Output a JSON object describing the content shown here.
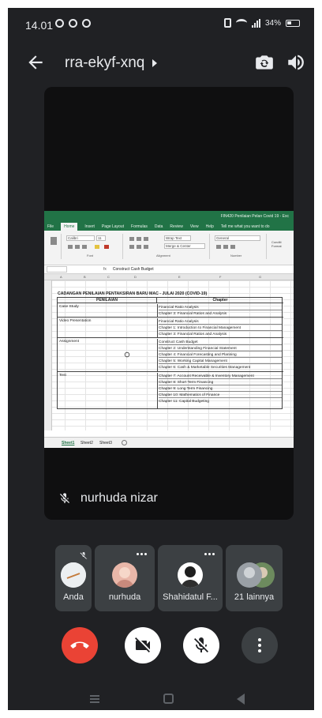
{
  "status_bar": {
    "time": "14.01",
    "battery": "34%"
  },
  "meeting": {
    "code": "rra-ekyf-xnq"
  },
  "presenter": {
    "name": "nurhuda nizar"
  },
  "excel": {
    "window_title": "FIN420 Penilaian Pelan Covid 19 - Exc",
    "tabs": [
      "File",
      "Home",
      "Insert",
      "Page Layout",
      "Formulas",
      "Data",
      "Review",
      "View",
      "Help",
      "Tell me what you want to do"
    ],
    "ribbon": {
      "font_name": "Calibri",
      "font_size": "11",
      "wrap_text": "Wrap Text",
      "merge_center": "Merge & Center",
      "number_format": "General",
      "groups": [
        "Font",
        "Alignment",
        "Number"
      ],
      "conditional": "Conditi Format"
    },
    "formula_bar": {
      "fx": "fx",
      "value": "Construct Cash Budget"
    },
    "columns": [
      "A",
      "B",
      "C",
      "D",
      "E",
      "F",
      "G"
    ],
    "caption": "CADANGAN PENILAIAN PENTAKSIRAN BARU MAC - JULAI 2020 (COVID-19)",
    "headers": [
      "PENILAIAN",
      "Chapter"
    ],
    "rows": [
      {
        "assessment": "Case Study",
        "chapters": [
          "Financial Ratio Analysis",
          "Chapter 3: Financial Ratios and Analysis"
        ]
      },
      {
        "assessment": "Video Presentation",
        "chapters": [
          "Financial Ratio Analysis",
          "Chapter 1: Introduction to Financial Management",
          "Chapter 3: Financial Ratios and Analysis"
        ]
      },
      {
        "assessment": "Assignment",
        "chapters": [
          "Construct Cash Budget",
          "Chapter 2: Understanding Financial Statement",
          "Chapter 4: Financial Forecasting and Planning",
          "Chapter 5: Working Capital Management",
          "Chapter 6: Cash & Marketable Securities Management"
        ]
      },
      {
        "assessment": "Test",
        "chapters": [
          "Chapter 7: Account Receivable & Inventory Management",
          "Chapter 8: Short Term Financing",
          "Chapter 9: Long Term Financing",
          "Chapter 10: Mathematics of Finance",
          "Chapter 11: Capital Budgeting"
        ]
      }
    ],
    "sheets": [
      "Sheet1",
      "Sheet2",
      "Sheet3"
    ]
  },
  "participants": [
    {
      "name": "Anda"
    },
    {
      "name": "nurhuda"
    },
    {
      "name": "Shahidatul F..."
    },
    {
      "name": "21 lainnya"
    }
  ],
  "colors": {
    "end_call": "#ea4335",
    "background": "#202124",
    "tile": "#3c4043",
    "excel_green": "#217346"
  }
}
